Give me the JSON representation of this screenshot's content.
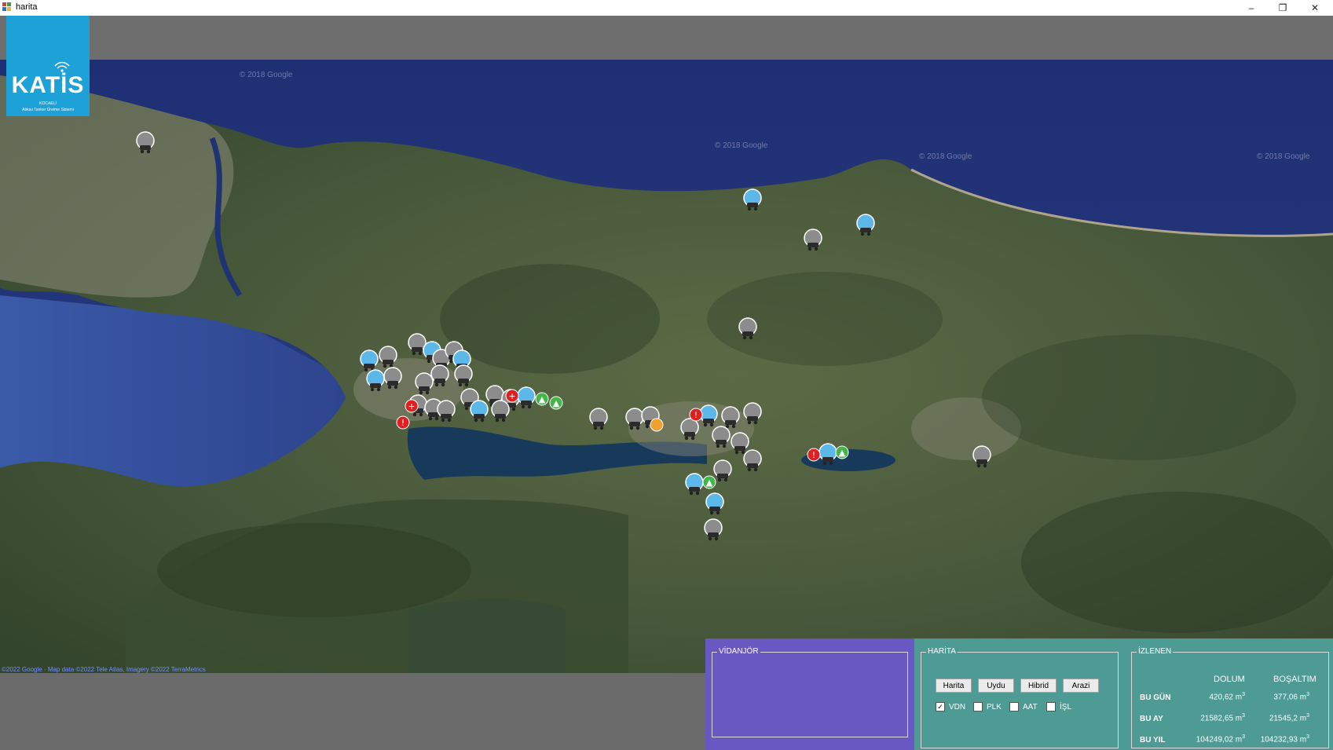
{
  "window": {
    "title": "harita",
    "minimize_label": "–",
    "restore_label": "❐",
    "close_label": "✕"
  },
  "logo": {
    "brand": "KATİS",
    "city": "KOCAELİ",
    "tagline": "Atıksu Tanker Üretme Sistemi"
  },
  "map": {
    "copyright_label": "© 2018 Google",
    "attribution": "©2022 Google · Map data ©2022 Tele Atlas, Imagery ©2022 TerraMetrics",
    "marker_colors": {
      "gray": "#8c8c8c",
      "blue": "#5bb8e8",
      "red": "#e02020",
      "green": "#43b649",
      "orange": "#f0a030"
    }
  },
  "vidanjor": {
    "legend": "VİDANJÖR"
  },
  "harita": {
    "legend": "HARİTA",
    "buttons": [
      "Harita",
      "Uydu",
      "Hibrid",
      "Arazi"
    ],
    "checkboxes": [
      {
        "label": "VDN",
        "checked": true
      },
      {
        "label": "PLK",
        "checked": false
      },
      {
        "label": "AAT",
        "checked": false
      },
      {
        "label": "İŞL",
        "checked": false
      }
    ]
  },
  "izlenen": {
    "legend": "İZLENEN",
    "col_dolum": "DOLUM",
    "col_bosaltim": "BOŞALTIM",
    "unit": "m",
    "unit_exp": "3",
    "rows": [
      {
        "label": "BU GÜN",
        "dolum": "420,62",
        "bosaltim": "377,06"
      },
      {
        "label": "BU AY",
        "dolum": "21582,65",
        "bosaltim": "21545,2"
      },
      {
        "label": "BU YIL",
        "dolum": "104249,02",
        "bosaltim": "104232,93"
      }
    ]
  }
}
